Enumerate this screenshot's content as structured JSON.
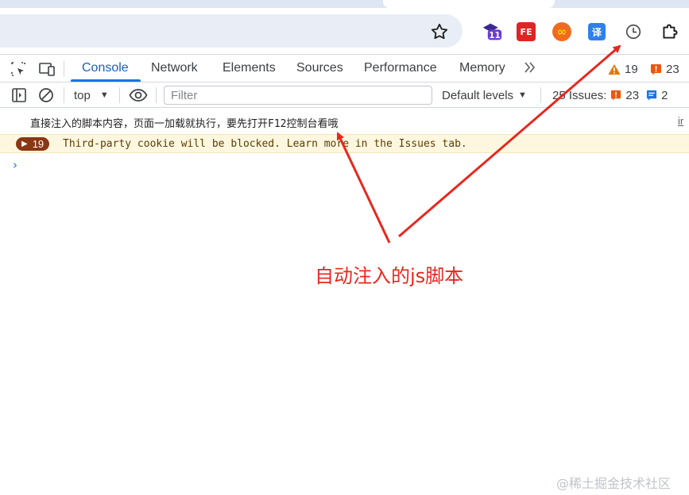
{
  "devtools": {
    "tabs": [
      "Console",
      "Network",
      "Elements",
      "Sources",
      "Performance",
      "Memory"
    ],
    "active_tab": "Console",
    "warnings_count": "19",
    "errors_count": "23"
  },
  "console_toolbar": {
    "context": "top",
    "filter_placeholder": "Filter",
    "levels": "Default levels",
    "issues_label": "25 Issues:",
    "issues_errors": "23",
    "issues_info": "2"
  },
  "console": {
    "log_text": "直接注入的脚本内容，页面一加载就执行，要先打开F12控制台看哦",
    "log_source": "ir",
    "warning_count": "19",
    "warning_text": "Third-party cookie will be blocked. Learn more in the Issues tab."
  },
  "extensions": {
    "badge_11": "11",
    "fe": "FE",
    "inf": "∞",
    "yi": "译"
  },
  "annotation_text": "自动注入的js脚本",
  "watermark": "@稀土掘金技术社区",
  "colors": {
    "accent": "#1a73e8",
    "annotation_red": "#e8271d",
    "warning_bg": "#fef7e0",
    "warning_badge": "#8a3714"
  }
}
